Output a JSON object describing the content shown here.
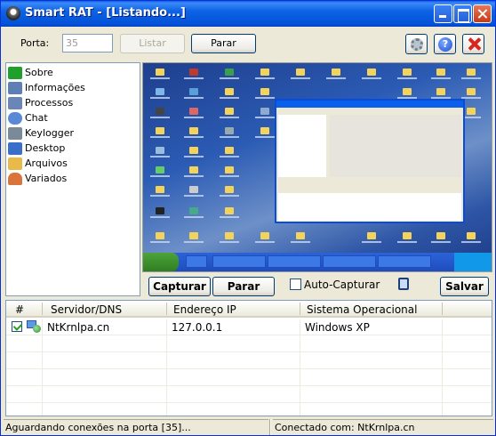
{
  "window": {
    "title": "Smart RAT - [Listando...]"
  },
  "toolbar": {
    "porta_label": "Porta:",
    "porta_value": "35",
    "listar_label": "Listar",
    "parar_label": "Parar",
    "settings_icon": "gear-icon",
    "help_icon": "help-icon",
    "close_icon": "red-x-icon"
  },
  "menu": {
    "items": [
      {
        "label": "Sobre",
        "icon": "brazil-flag-icon",
        "color": "#1FA02A"
      },
      {
        "label": "Informações",
        "icon": "computer-info-icon",
        "color": "#5D7FB5"
      },
      {
        "label": "Processos",
        "icon": "processes-icon",
        "color": "#6A86B6"
      },
      {
        "label": "Chat",
        "icon": "chat-icon",
        "color": "#5A8AD6"
      },
      {
        "label": "Keylogger",
        "icon": "keyboard-icon",
        "color": "#7A8A99"
      },
      {
        "label": "Desktop",
        "icon": "desktop-icon",
        "color": "#3A6FC9"
      },
      {
        "label": "Arquivos",
        "icon": "folder-icon",
        "color": "#E9B949"
      },
      {
        "label": "Variados",
        "icon": "user-icon",
        "color": "#D9743B"
      }
    ]
  },
  "preview_controls": {
    "capturar_label": "Capturar",
    "parar_label": "Parar",
    "auto_capturar_label": "Auto-Capturar",
    "auto_capturar_checked": false,
    "salvar_label": "Salvar"
  },
  "table": {
    "columns": [
      "#",
      "Servidor/DNS",
      "Endereço IP",
      "Sistema Operacional"
    ],
    "rows": [
      {
        "checked": true,
        "servidor": "NtKrnlpa.cn",
        "ip": "127.0.0.1",
        "so": "Windows XP"
      }
    ]
  },
  "statusbar": {
    "left": "Aguardando conexões na porta [35]...",
    "right": "Conectado com: NtKrnlpa.cn"
  }
}
